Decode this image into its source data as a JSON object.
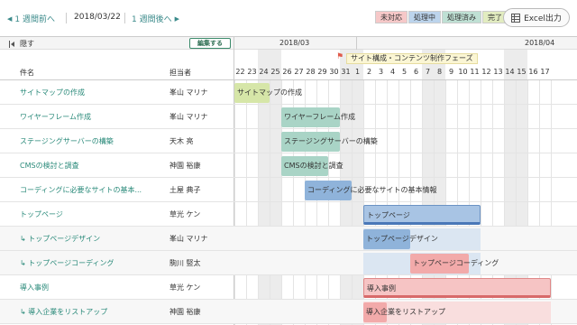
{
  "nav": {
    "prev": "1 週間前へ",
    "date": "2018/03/22",
    "next": "1 週間後へ"
  },
  "legend": [
    {
      "label": "未対応",
      "color": "#f6c8c8"
    },
    {
      "label": "処理中",
      "color": "#bcd4ec"
    },
    {
      "label": "処理済み",
      "color": "#bfe0d4"
    },
    {
      "label": "完了",
      "color": "#e2ecc0"
    }
  ],
  "excel_label": "Excel出力",
  "header": {
    "hide_label": "隠す",
    "edit_label": "編集する",
    "month1": "2018/03",
    "month2": "2018/04",
    "col_task": "件名",
    "col_owner": "担当者",
    "phase": "サイト構成・コンテンツ制作フェーズ"
  },
  "days": [
    "22",
    "23",
    "24",
    "25",
    "26",
    "27",
    "28",
    "29",
    "30",
    "31",
    "1",
    "2",
    "3",
    "4",
    "5",
    "6",
    "7",
    "8",
    "9",
    "10",
    "11",
    "12",
    "13",
    "14",
    "15",
    "16",
    "17"
  ],
  "rows": [
    {
      "task": "サイトマップの作成",
      "owner": "峯山 マリナ",
      "sub": false
    },
    {
      "task": "ワイヤーフレーム作成",
      "owner": "峯山 マリナ",
      "sub": false
    },
    {
      "task": "ステージングサーバーの構築",
      "owner": "天木 亮",
      "sub": false
    },
    {
      "task": "CMSの検討と調査",
      "owner": "神園 裕康",
      "sub": false
    },
    {
      "task": "コーディングに必要なサイトの基本...",
      "owner": "土屋 典子",
      "sub": false
    },
    {
      "task": "トップページ",
      "owner": "草光 ケン",
      "sub": false
    },
    {
      "task": "↳ トップページデザイン",
      "owner": "峯山 マリナ",
      "sub": true
    },
    {
      "task": "↳ トップページコーディング",
      "owner": "駒川 竪太",
      "sub": true
    },
    {
      "task": "導入事例",
      "owner": "草光 ケン",
      "sub": false
    },
    {
      "task": "↳ 導入企業をリストアップ",
      "owner": "神園 裕康",
      "sub": true
    }
  ],
  "bars": [
    {
      "row": 0,
      "label": "サイトマップの作成",
      "start": 0,
      "end": 2,
      "style": "green"
    },
    {
      "row": 1,
      "label": "ワイヤーフレーム作成",
      "start": 4,
      "end": 8,
      "style": "teal"
    },
    {
      "row": 2,
      "label": "ステージングサーバーの構築",
      "start": 4,
      "end": 8,
      "style": "teal"
    },
    {
      "row": 3,
      "label": "CMSの検討と調査",
      "start": 4,
      "end": 7,
      "style": "teal"
    },
    {
      "row": 4,
      "label": "コーディングに必要なサイトの基本情報",
      "start": 6,
      "end": 9,
      "style": "blue"
    },
    {
      "row": 5,
      "label": "トップページ",
      "start": 11,
      "end": 20,
      "style": "blue-outline"
    },
    {
      "row": 6,
      "label": "トップページデザイン",
      "start": 11,
      "end": 14,
      "style": "blue"
    },
    {
      "row": 7,
      "label": "トップページコーディング",
      "start": 15,
      "end": 19,
      "style": "pink"
    },
    {
      "row": 8,
      "label": "導入事例",
      "start": 11,
      "end": 26,
      "style": "red-outline"
    },
    {
      "row": 9,
      "label": "導入企業をリストアップ",
      "start": 11,
      "end": 12,
      "style": "pink"
    }
  ]
}
